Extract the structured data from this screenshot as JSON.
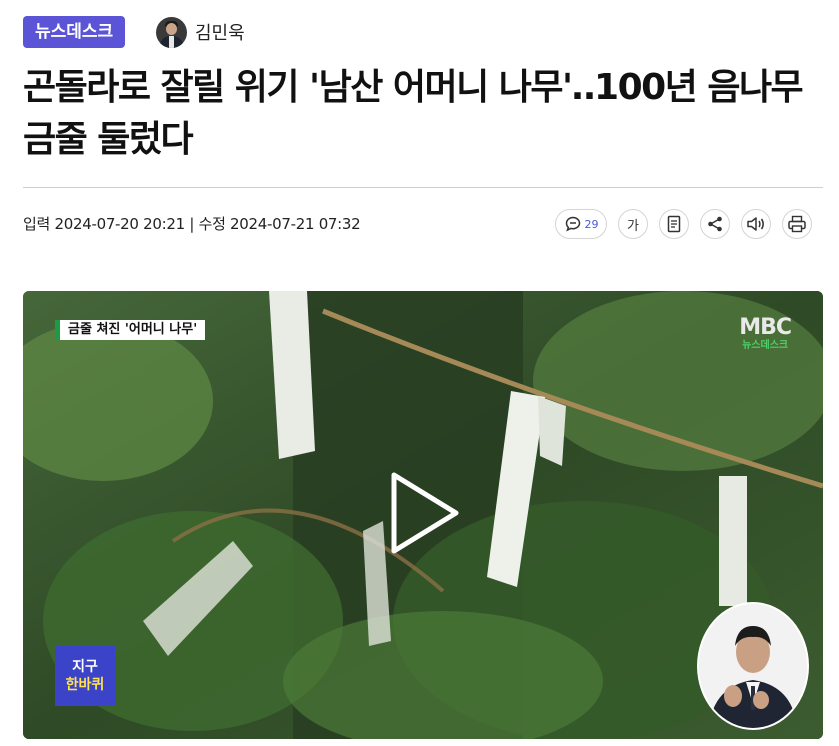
{
  "section_badge": "뉴스데스크",
  "author": {
    "name": "김민욱"
  },
  "headline": "곤돌라로 잘릴 위기 '남산 어머니 나무'‥100년 음나무 금줄 둘렀다",
  "dates": {
    "published_label": "입력",
    "published": "2024-07-20 20:21",
    "separator": "|",
    "updated_label": "수정",
    "updated": "2024-07-21 07:32"
  },
  "toolbar": {
    "comment_count": "29",
    "font_size_glyph": "가",
    "icons": [
      "comment-icon",
      "font-size-icon",
      "bookmark-icon",
      "share-icon",
      "audio-icon",
      "print-icon"
    ]
  },
  "video": {
    "caption": "금줄 쳐진 '어머니 나무'",
    "logo_main": "MBC",
    "logo_sub": "뉴스데스크",
    "corner_badge_line1": "지구",
    "corner_badge_line2": "한바퀴",
    "play_icon": "play-icon"
  },
  "colors": {
    "badge_bg": "#5b54d6",
    "comment_accent": "#4a5bd6",
    "logo_green": "#4fd16a",
    "corner_badge_bg": "#3b44c9"
  }
}
